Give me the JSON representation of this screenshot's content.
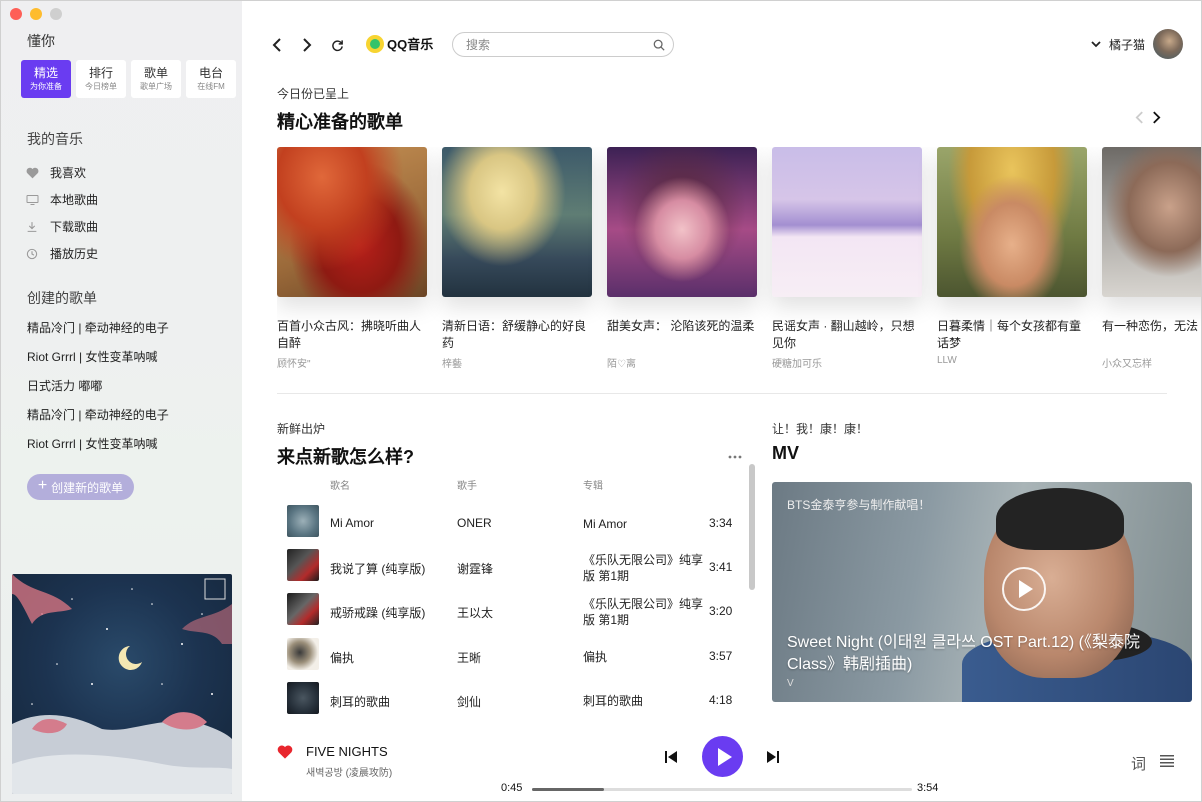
{
  "app": {
    "name": "懂你"
  },
  "nav_tabs": [
    {
      "label": "精选",
      "sub": "为你准备",
      "active": true
    },
    {
      "label": "排行",
      "sub": "今日榜单",
      "active": false
    },
    {
      "label": "歌单",
      "sub": "歌单广场",
      "active": false
    },
    {
      "label": "电台",
      "sub": "在线FM",
      "active": false
    }
  ],
  "my_music": {
    "heading": "我的音乐",
    "items": [
      {
        "label": "我喜欢",
        "icon": "heart-icon"
      },
      {
        "label": "本地歌曲",
        "icon": "monitor-icon"
      },
      {
        "label": "下载歌曲",
        "icon": "download-icon"
      },
      {
        "label": "播放历史",
        "icon": "history-icon"
      }
    ]
  },
  "created_playlists": {
    "heading": "创建的歌单",
    "items": [
      "精品冷门 | 牵动神经的电子",
      "Riot Grrrl | 女性变革呐喊",
      "日式活力 嘟嘟",
      "精品冷门 | 牵动神经的电子",
      "Riot Grrrl | 女性变革呐喊"
    ],
    "create_label": "创建新的歌单"
  },
  "topbar": {
    "logo_text": "QQ音乐",
    "search_placeholder": "搜索",
    "user_name": "橘子猫"
  },
  "recommend": {
    "subtitle": "今日份已呈上",
    "title": "精心准备的歌单",
    "cards": [
      {
        "title": "百首小众古风：拂晓听曲人自醉",
        "author": "顾怀安\""
      },
      {
        "title": "清新日语：舒缓静心的好良药",
        "author": "梓藝"
      },
      {
        "title": "甜美女声： 沦陷该死的温柔",
        "author": "陌♡离"
      },
      {
        "title": "民谣女声 · 翻山越岭，只想见你",
        "author": "硬糖加可乐"
      },
      {
        "title": "日暮柔情｜每个女孩都有童话梦",
        "author": "LLW"
      },
      {
        "title": "有一种恋伤，无法",
        "author": "小众又忘样"
      }
    ]
  },
  "new_songs": {
    "subtitle": "新鲜出炉",
    "title": "来点新歌怎么样?",
    "columns": {
      "name": "歌名",
      "artist": "歌手",
      "album": "专辑"
    },
    "songs": [
      {
        "name": "Mi Amor",
        "artist": "ONER",
        "album": "Mi Amor",
        "duration": "3:34"
      },
      {
        "name": "我说了算 (纯享版)",
        "artist": "谢霆锋",
        "album": "《乐队无限公司》纯享版 第1期",
        "duration": "3:41"
      },
      {
        "name": "戒骄戒躁 (纯享版)",
        "artist": "王以太",
        "album": "《乐队无限公司》纯享版 第1期",
        "duration": "3:20"
      },
      {
        "name": "偏执",
        "artist": "王晰",
        "album": "偏执",
        "duration": "3:57"
      },
      {
        "name": "刺耳的歌曲",
        "artist": "剑仙",
        "album": "刺耳的歌曲",
        "duration": "4:18"
      }
    ]
  },
  "mv": {
    "subtitle": "让！我！康！康！",
    "title": "MV",
    "card_subtitle": "BTS金泰亨参与制作献唱！",
    "card_title": "Sweet Night (이태원 클라쓰 OST Part.12) (《梨泰院Class》韩剧插曲)",
    "card_artist": "V"
  },
  "player": {
    "title": "FIVE NIGHTS",
    "artist": "새벽공방 (凌晨攻防)",
    "current_time": "0:45",
    "total_time": "3:54",
    "progress": 0.19,
    "lyric_label": "词",
    "liked": true
  },
  "colors": {
    "accent": "#6a3cf1",
    "heart": "#e8262d"
  }
}
